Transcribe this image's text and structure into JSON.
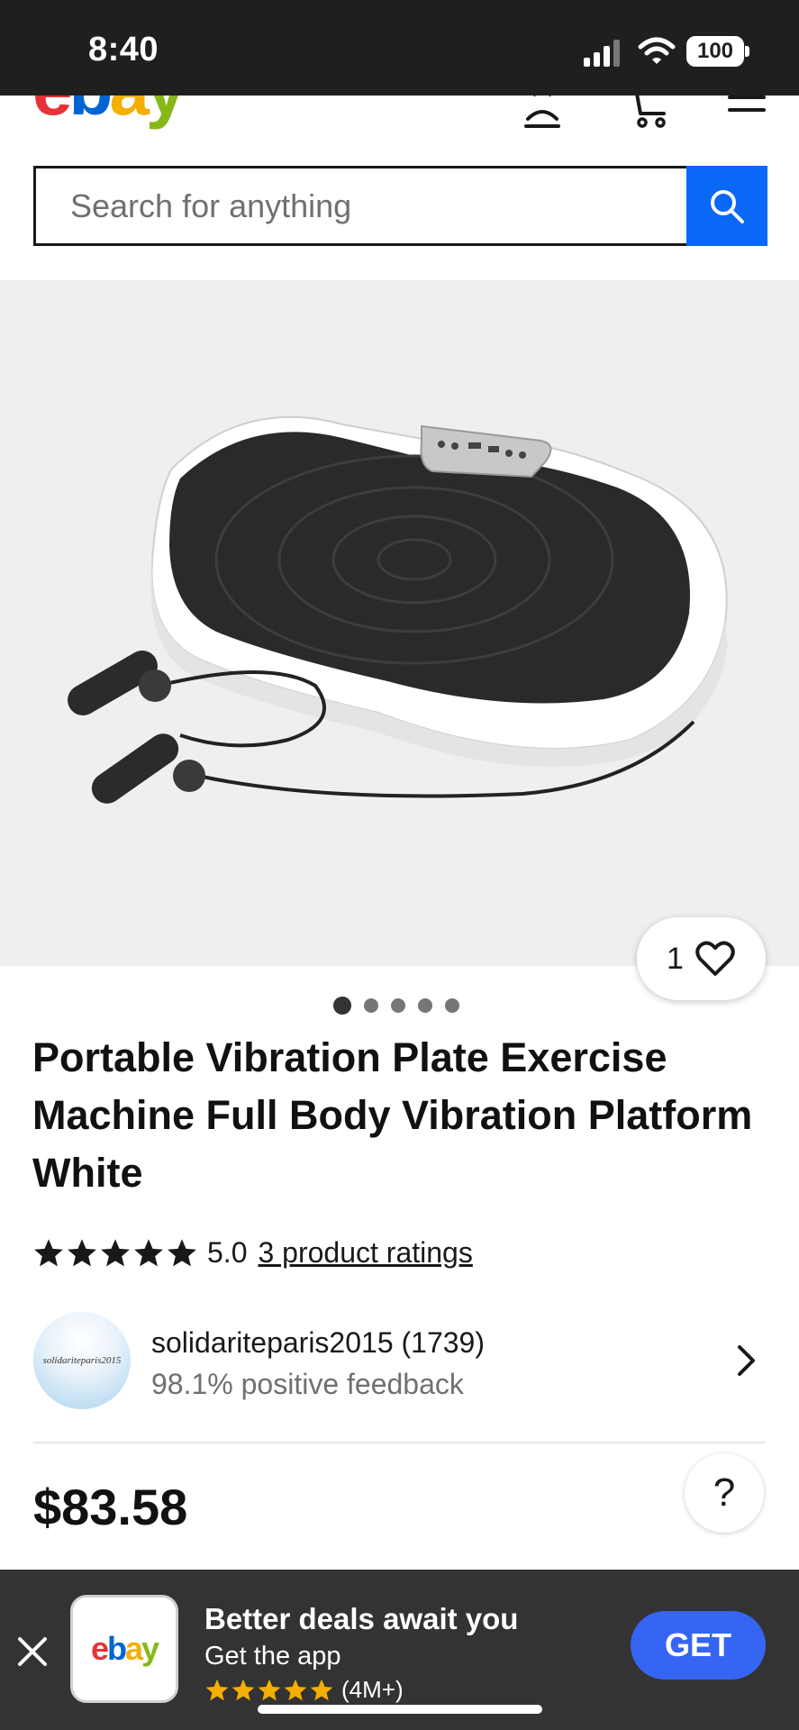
{
  "status_bar": {
    "time": "8:40",
    "battery": "100"
  },
  "header": {
    "logo_letters": [
      {
        "char": "e",
        "color": "#e53238"
      },
      {
        "char": "b",
        "color": "#0064d2"
      },
      {
        "char": "a",
        "color": "#f5af02"
      },
      {
        "char": "y",
        "color": "#86b817"
      }
    ],
    "icons": [
      "account-icon",
      "cart-icon",
      "menu-icon"
    ]
  },
  "search": {
    "placeholder": "Search for anything"
  },
  "gallery": {
    "watch_count": "1",
    "image_count": 5,
    "active_index": 0
  },
  "product": {
    "title": "Portable Vibration Plate Exercise Machine Full Body Vibration Platform White",
    "rating_value": "5.0",
    "rating_stars": 5,
    "ratings_link": "3 product ratings",
    "price": "$83.58"
  },
  "seller": {
    "avatar_text": "solidariteparis2015",
    "name": "solidariteparis2015 (1739)",
    "feedback": "98.1% positive feedback"
  },
  "help": {
    "label": "?"
  },
  "app_banner": {
    "title": "Better deals await you",
    "subtitle": "Get the app",
    "rating_stars": 5,
    "rating_count": "(4M+)",
    "get_label": "GET",
    "app_icon_letters": [
      {
        "char": "e",
        "color": "#e53238"
      },
      {
        "char": "b",
        "color": "#0064d2"
      },
      {
        "char": "a",
        "color": "#f5af02"
      },
      {
        "char": "y",
        "color": "#86b817"
      }
    ]
  },
  "colors": {
    "accent": "#0968f6",
    "get_button": "#3665f3",
    "banner_bg": "#333333",
    "star_gold": "#f5af02"
  }
}
